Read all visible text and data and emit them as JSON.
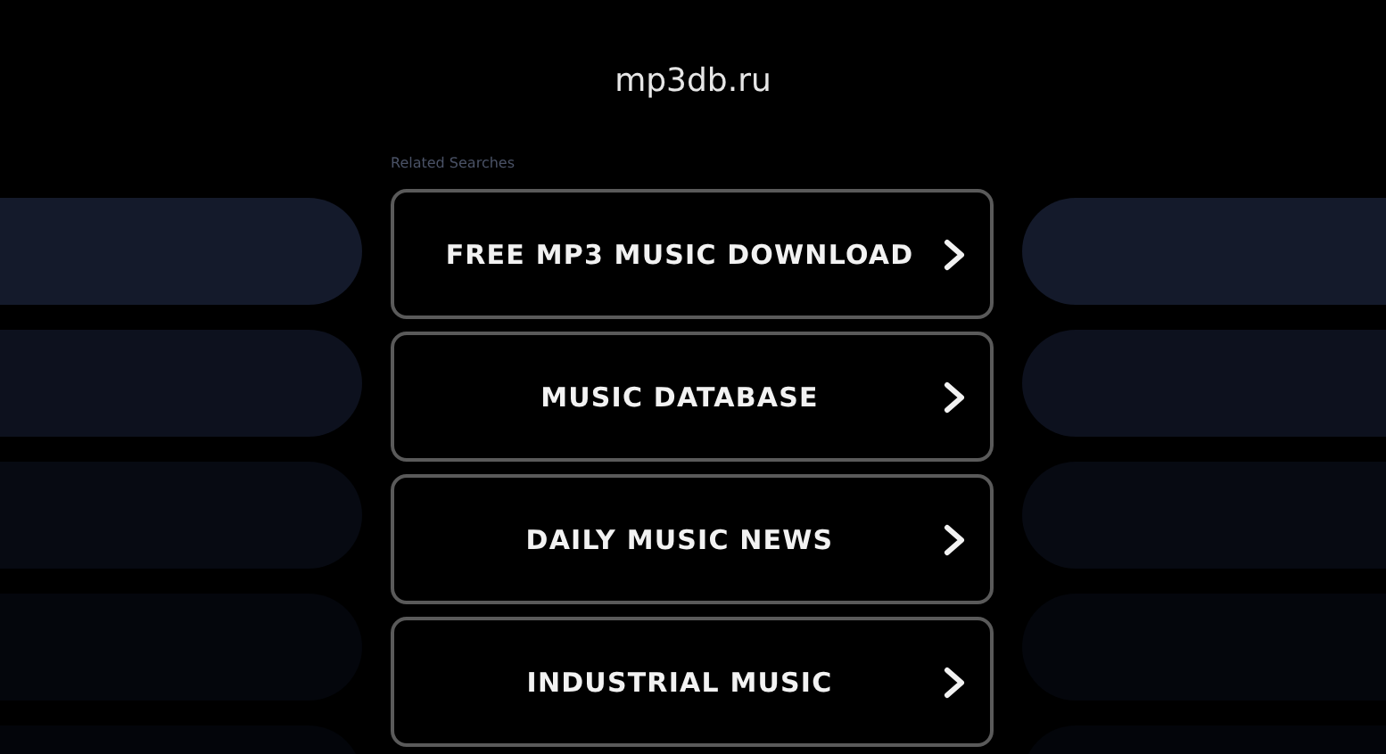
{
  "site_title": "mp3db.ru",
  "related_searches_label": "Related Searches",
  "searches": [
    {
      "label": "FREE MP3 MUSIC DOWNLOAD"
    },
    {
      "label": "MUSIC DATABASE"
    },
    {
      "label": "DAILY MUSIC NEWS"
    },
    {
      "label": "INDUSTRIAL MUSIC"
    }
  ]
}
